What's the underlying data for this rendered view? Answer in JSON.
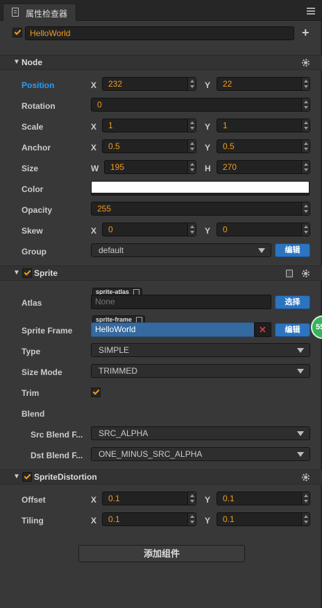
{
  "tab": {
    "title": "属性检查器",
    "icon": "inspector-icon",
    "menu_icon": "hamburger-menu-icon"
  },
  "node": {
    "enabled": true,
    "name": "HelloWorld",
    "add_icon": "plus-icon"
  },
  "sections": {
    "node": {
      "title": "Node",
      "icon": "gear-icon"
    },
    "sprite": {
      "title": "Sprite",
      "enabled": true,
      "icons": [
        "book-icon",
        "gear-icon"
      ]
    },
    "distortion": {
      "title": "SpriteDistortion",
      "enabled": true,
      "icon": "gear-icon"
    }
  },
  "props": {
    "position": {
      "label": "Position",
      "x_label": "X",
      "x": "232",
      "y_label": "Y",
      "y": "22"
    },
    "rotation": {
      "label": "Rotation",
      "value": "0"
    },
    "scale": {
      "label": "Scale",
      "x_label": "X",
      "x": "1",
      "y_label": "Y",
      "y": "1"
    },
    "anchor": {
      "label": "Anchor",
      "x_label": "X",
      "x": "0.5",
      "y_label": "Y",
      "y": "0.5"
    },
    "size": {
      "label": "Size",
      "w_label": "W",
      "w": "195",
      "h_label": "H",
      "h": "270"
    },
    "color": {
      "label": "Color",
      "value": "#ffffff"
    },
    "opacity": {
      "label": "Opacity",
      "value": "255"
    },
    "skew": {
      "label": "Skew",
      "x_label": "X",
      "x": "0",
      "y_label": "Y",
      "y": "0"
    },
    "group": {
      "label": "Group",
      "value": "default",
      "button": "编辑"
    }
  },
  "sprite": {
    "atlas": {
      "label": "Atlas",
      "tag": "sprite-atlas",
      "value": "None",
      "button": "选择"
    },
    "frame": {
      "label": "Sprite Frame",
      "tag": "sprite-frame",
      "value": "HelloWorld",
      "clear": "✕",
      "button": "编辑"
    },
    "type": {
      "label": "Type",
      "value": "SIMPLE"
    },
    "size_mode": {
      "label": "Size Mode",
      "value": "TRIMMED"
    },
    "trim": {
      "label": "Trim",
      "checked": true
    },
    "blend": {
      "label": "Blend"
    },
    "src_blend": {
      "label": "Src Blend F...",
      "value": "SRC_ALPHA"
    },
    "dst_blend": {
      "label": "Dst Blend F...",
      "value": "ONE_MINUS_SRC_ALPHA"
    }
  },
  "distortion": {
    "offset": {
      "label": "Offset",
      "x_label": "X",
      "x": "0.1",
      "y_label": "Y",
      "y": "0.1"
    },
    "tiling": {
      "label": "Tiling",
      "x_label": "X",
      "x": "0.1",
      "y_label": "Y",
      "y": "0.1"
    }
  },
  "add_component": "添加组件",
  "overlay_badge": "55",
  "colors": {
    "accent": "#f39c1d",
    "active_label": "#2a9df4",
    "button_blue": "#2c74c0",
    "badge_green": "#34b559"
  }
}
